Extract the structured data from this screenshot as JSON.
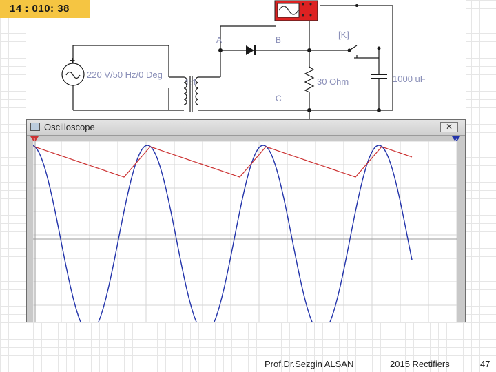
{
  "timer": "14 : 010: 38",
  "circuit": {
    "source_label": "220 V/50 Hz/0 Deg",
    "transformer_ratio": "1:1",
    "node_a": "A",
    "node_b": "B",
    "node_c": "C",
    "resistor_label": "30  Ohm",
    "capacitor_label": "1000 uF",
    "switch_label": "[K]",
    "source_plus": "+"
  },
  "oscilloscope": {
    "title": "Oscilloscope",
    "close_glyph": "✕",
    "channel_a_marker": "1",
    "channel_b_marker": "2",
    "channel_a_color": "#cc3333",
    "channel_b_color": "#2233aa"
  },
  "footer": {
    "author": "Prof.Dr.Sezgin ALSAN",
    "course": "2015 Rectifiers",
    "page": "47"
  }
}
